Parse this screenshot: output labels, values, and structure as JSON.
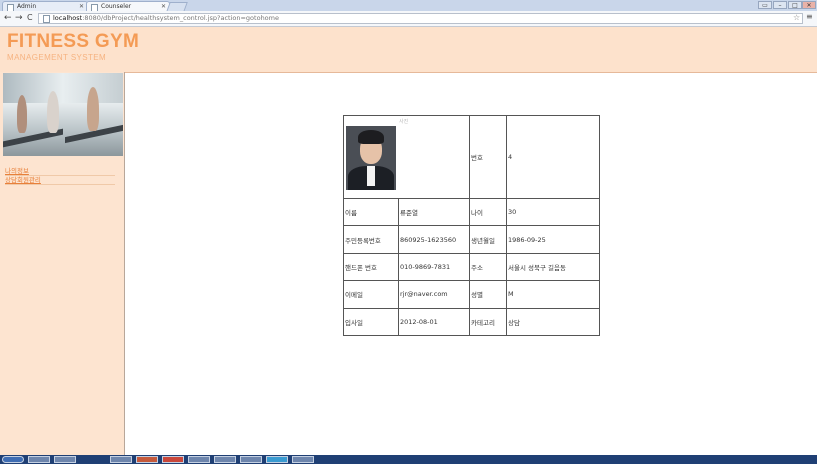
{
  "browser": {
    "tabs": [
      {
        "label": "Admin",
        "active": false
      },
      {
        "label": "Counseler",
        "active": true
      }
    ],
    "url_host": "localhost",
    "url_rest": ":8080/dbProject/healthsystem_control.jsp?action=gotohome"
  },
  "header": {
    "title": "FITNESS GYM",
    "subtitle": "MANAGEMENT SYSTEM"
  },
  "sidebar": {
    "links": [
      "나의정보",
      "상담회원관리"
    ]
  },
  "profile": {
    "photo_caption": "사진",
    "rows": [
      {
        "l1": "",
        "v1": "",
        "l2": "번호",
        "v2": "4"
      },
      {
        "l1": "이름",
        "v1": "류준열",
        "l2": "나이",
        "v2": "30"
      },
      {
        "l1": "주민등록번호",
        "v1": "860925-1623560",
        "l2": "생년월일",
        "v2": "1986-09-25"
      },
      {
        "l1": "핸드폰 번호",
        "v1": "010-9869-7831",
        "l2": "주소",
        "v2": "서울시 성북구 길음동"
      },
      {
        "l1": "이메일",
        "v1": "rjr@naver.com",
        "l2": "성별",
        "v2": "M"
      },
      {
        "l1": "입사일",
        "v1": "2012-08-01",
        "l2": "카테고리",
        "v2": "상담"
      }
    ]
  },
  "colors": {
    "accent": "#f49b55",
    "header_bg": "#fde2cc",
    "sidebar_bg": "#fde4d0",
    "link": "#e8803a"
  }
}
